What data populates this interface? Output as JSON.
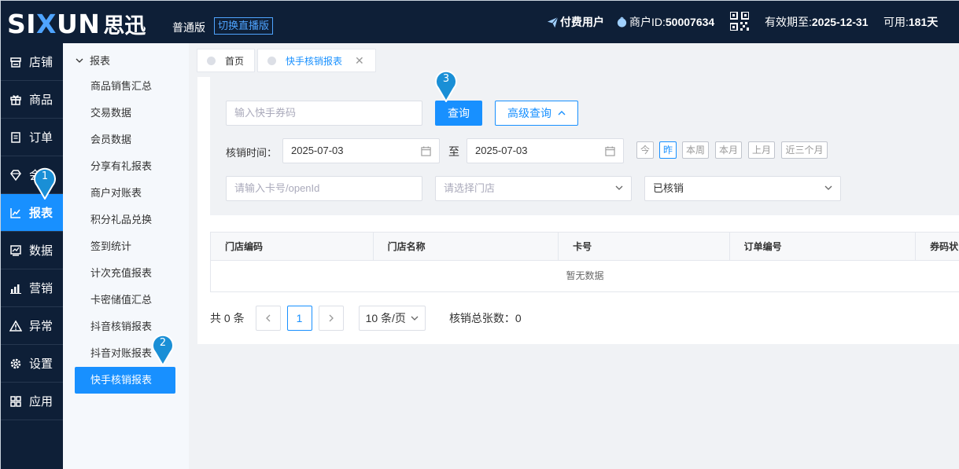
{
  "header": {
    "logo_a": "SI",
    "logo_x": "X",
    "logo_b": "UN",
    "logo_cn": "思迅",
    "edition": "普通版",
    "switch_label": "切换直播版",
    "paid_user": "付费用户",
    "merchant_label": "商户ID:",
    "merchant_id": "50007634",
    "expiry_label": "有效期至:",
    "expiry_date": "2025-12-31",
    "available_label": "可用:",
    "available_days": "181天"
  },
  "nav": {
    "items": [
      {
        "label": "店铺",
        "icon": "store-icon"
      },
      {
        "label": "商品",
        "icon": "gift-icon"
      },
      {
        "label": "订单",
        "icon": "clipboard-icon"
      },
      {
        "label": "会员",
        "icon": "diamond-icon"
      },
      {
        "label": "报表",
        "icon": "chart-icon"
      },
      {
        "label": "数据",
        "icon": "trend-icon"
      },
      {
        "label": "营销",
        "icon": "bar-icon"
      },
      {
        "label": "异常",
        "icon": "warning-icon"
      },
      {
        "label": "设置",
        "icon": "gear-icon"
      },
      {
        "label": "应用",
        "icon": "apps-icon"
      }
    ],
    "active_index": 4
  },
  "submenu": {
    "header": "报表",
    "items": [
      "商品销售汇总",
      "交易数据",
      "会员数据",
      "分享有礼报表",
      "商户对账表",
      "积分礼品兑换",
      "签到统计",
      "计次充值报表",
      "卡密储值汇总",
      "抖音核销报表",
      "抖音对账报表",
      "快手核销报表"
    ],
    "active_index": 11
  },
  "tabs": [
    {
      "label": "首页"
    },
    {
      "label": "快手核销报表"
    }
  ],
  "search": {
    "coupon_placeholder": "输入快手券码",
    "query_label": "查询",
    "advanced_label": "高级查询",
    "time_label": "核销时间：",
    "start_date": "2025-07-03",
    "to_label": "至",
    "end_date": "2025-07-03",
    "quick": [
      "今",
      "昨",
      "本周",
      "本月",
      "上月",
      "近三个月"
    ],
    "quick_active_index": 1,
    "card_placeholder": "请输入卡号/openId",
    "store_placeholder": "请选择门店",
    "status_value": "已核销"
  },
  "table": {
    "columns": [
      "门店编码",
      "门店名称",
      "卡号",
      "订单编号",
      "券码状"
    ],
    "empty_text": "暂无数据"
  },
  "pager": {
    "total": "共 0 条",
    "current_page": "1",
    "page_size": "10 条/页",
    "summary": "核销总张数：0"
  },
  "markers": [
    "1",
    "2",
    "3"
  ],
  "colors": {
    "header_bg": "#0e1f37",
    "accent": "#1890ff",
    "marker": "#1a8fd6"
  }
}
